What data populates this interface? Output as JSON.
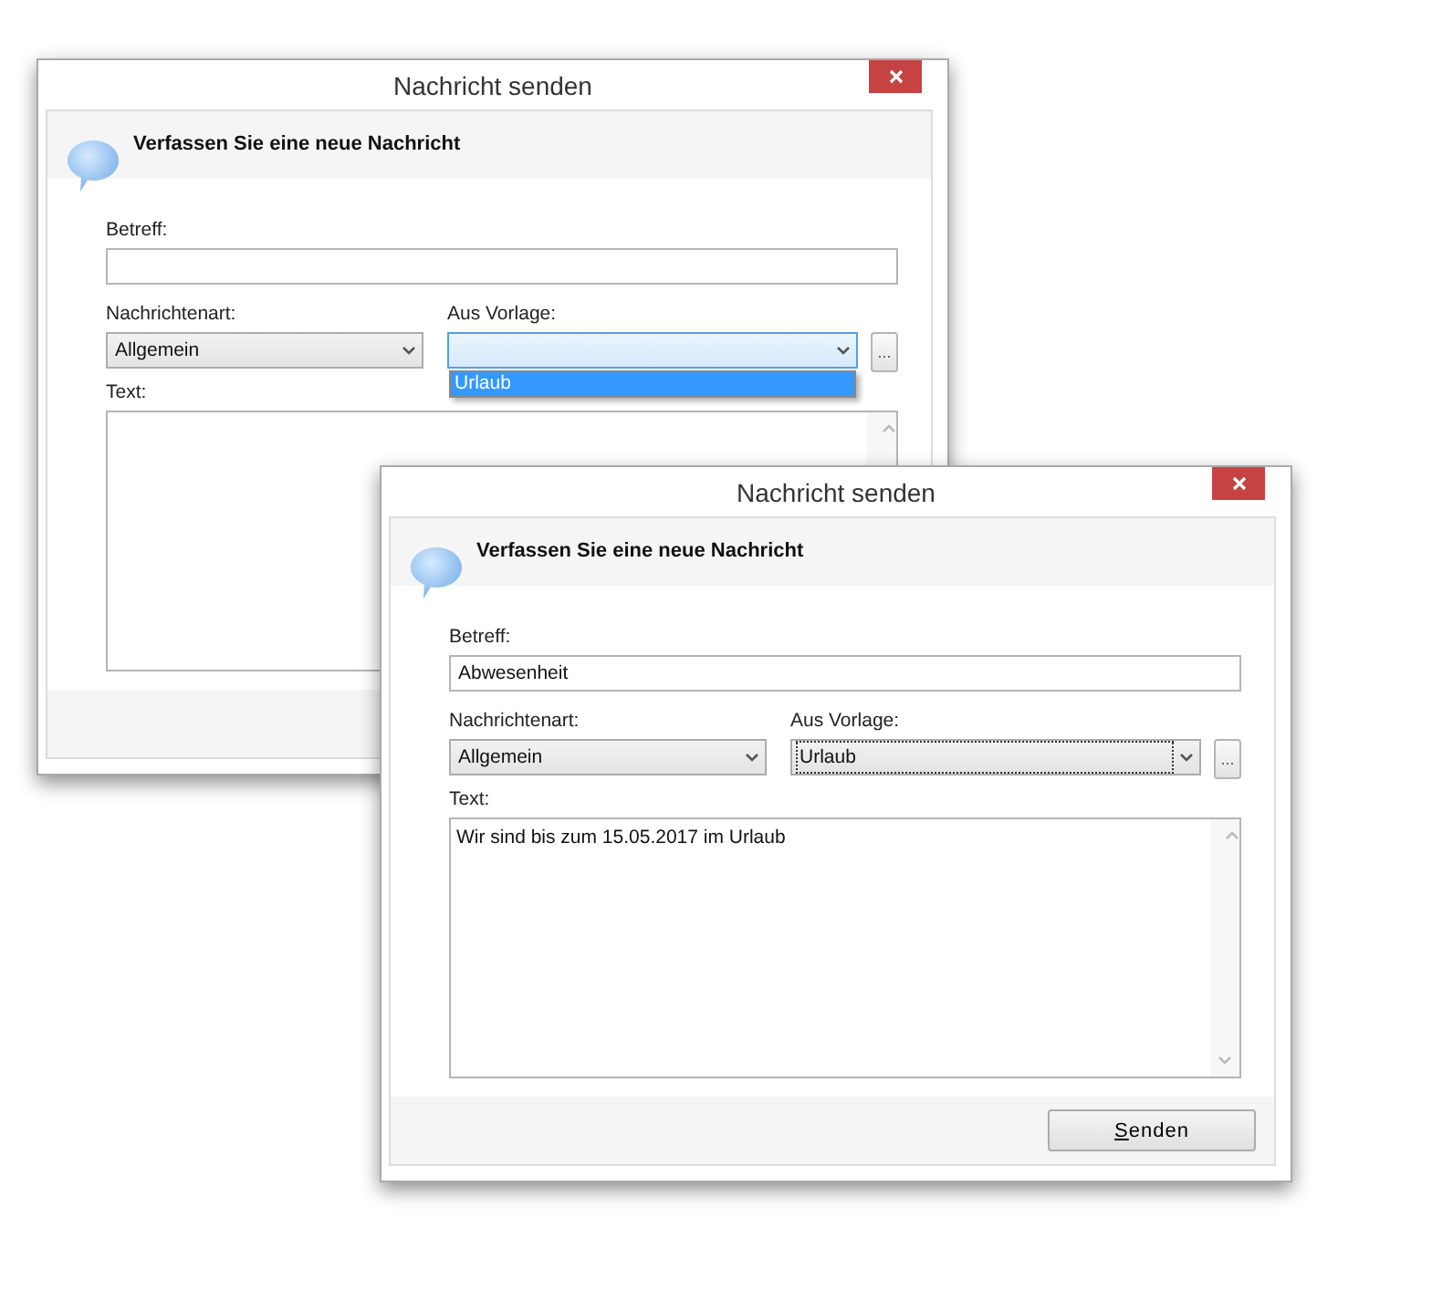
{
  "windows": [
    {
      "title": "Nachricht senden",
      "heading": "Verfassen Sie eine neue Nachricht",
      "subject": {
        "label": "Betreff:"
      },
      "message_type": {
        "label": "Nachrichtenart:",
        "value": "Allgemein",
        "expanded": false,
        "focused": false
      },
      "template": {
        "label": "Aus Vorlage:",
        "expanded": true,
        "focused": false,
        "options": [
          {
            "label": "Urlaub",
            "selected": true
          }
        ]
      },
      "browse_button": "...",
      "text": {
        "label": "Text:"
      }
    },
    {
      "title": "Nachricht senden",
      "heading": "Verfassen Sie eine neue Nachricht",
      "subject": {
        "label": "Betreff:",
        "value": "Abwesenheit"
      },
      "message_type": {
        "label": "Nachrichtenart:",
        "value": "Allgemein",
        "expanded": false,
        "focused": false
      },
      "template": {
        "label": "Aus Vorlage:",
        "value": "Urlaub",
        "expanded": false,
        "focused": true
      },
      "browse_button": "...",
      "text": {
        "label": "Text:",
        "value": "Wir sind bis zum 15.05.2017 im Urlaub"
      },
      "send_button": "Senden"
    }
  ]
}
